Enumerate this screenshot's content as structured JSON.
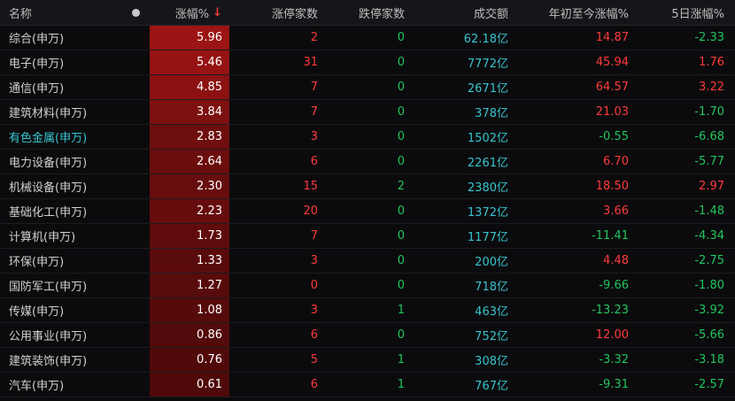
{
  "header": {
    "name": "名称",
    "change": "涨幅%",
    "sort_icon": "↓",
    "limit_up": "涨停家数",
    "limit_down": "跌停家数",
    "volume": "成交额",
    "ytd": "年初至今涨幅%",
    "five_day": "5日涨幅%"
  },
  "colors": {
    "up": "#ff3b3b",
    "down": "#22c55e",
    "volume": "#39c5cf",
    "highlight_bg_max": "#9c1414"
  },
  "rows": [
    {
      "name": "综合(申万)",
      "change": "5.96",
      "up": "2",
      "down": "0",
      "volume": "62.18亿",
      "ytd": "14.87",
      "five": "-2.33",
      "highlight": false
    },
    {
      "name": "电子(申万)",
      "change": "5.46",
      "up": "31",
      "down": "0",
      "volume": "7772亿",
      "ytd": "45.94",
      "five": "1.76",
      "highlight": false
    },
    {
      "name": "通信(申万)",
      "change": "4.85",
      "up": "7",
      "down": "0",
      "volume": "2671亿",
      "ytd": "64.57",
      "five": "3.22",
      "highlight": false
    },
    {
      "name": "建筑材料(申万)",
      "change": "3.84",
      "up": "7",
      "down": "0",
      "volume": "378亿",
      "ytd": "21.03",
      "five": "-1.70",
      "highlight": false
    },
    {
      "name": "有色金属(申万)",
      "change": "2.83",
      "up": "3",
      "down": "0",
      "volume": "1502亿",
      "ytd": "-0.55",
      "five": "-6.68",
      "highlight": true
    },
    {
      "name": "电力设备(申万)",
      "change": "2.64",
      "up": "6",
      "down": "0",
      "volume": "2261亿",
      "ytd": "6.70",
      "five": "-5.77",
      "highlight": false
    },
    {
      "name": "机械设备(申万)",
      "change": "2.30",
      "up": "15",
      "down": "2",
      "volume": "2380亿",
      "ytd": "18.50",
      "five": "2.97",
      "highlight": false
    },
    {
      "name": "基础化工(申万)",
      "change": "2.23",
      "up": "20",
      "down": "0",
      "volume": "1372亿",
      "ytd": "3.66",
      "five": "-1.48",
      "highlight": false
    },
    {
      "name": "计算机(申万)",
      "change": "1.73",
      "up": "7",
      "down": "0",
      "volume": "1177亿",
      "ytd": "-11.41",
      "five": "-4.34",
      "highlight": false
    },
    {
      "name": "环保(申万)",
      "change": "1.33",
      "up": "3",
      "down": "0",
      "volume": "200亿",
      "ytd": "4.48",
      "five": "-2.75",
      "highlight": false
    },
    {
      "name": "国防军工(申万)",
      "change": "1.27",
      "up": "0",
      "down": "0",
      "volume": "718亿",
      "ytd": "-9.66",
      "five": "-1.80",
      "highlight": false
    },
    {
      "name": "传媒(申万)",
      "change": "1.08",
      "up": "3",
      "down": "1",
      "volume": "463亿",
      "ytd": "-13.23",
      "five": "-3.92",
      "highlight": false
    },
    {
      "name": "公用事业(申万)",
      "change": "0.86",
      "up": "6",
      "down": "0",
      "volume": "752亿",
      "ytd": "12.00",
      "five": "-5.66",
      "highlight": false
    },
    {
      "name": "建筑装饰(申万)",
      "change": "0.76",
      "up": "5",
      "down": "1",
      "volume": "308亿",
      "ytd": "-3.32",
      "five": "-3.18",
      "highlight": false
    },
    {
      "name": "汽车(申万)",
      "change": "0.61",
      "up": "6",
      "down": "1",
      "volume": "767亿",
      "ytd": "-9.31",
      "five": "-2.57",
      "highlight": false
    }
  ]
}
